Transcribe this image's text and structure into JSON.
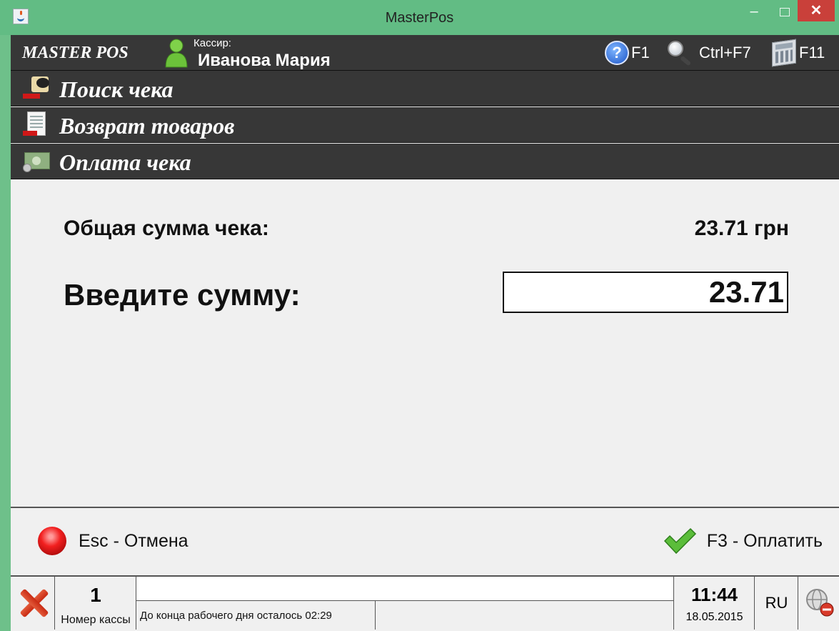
{
  "window": {
    "title": "MasterPos",
    "minimize": "–",
    "close": "✕"
  },
  "header": {
    "brand": "MASTER POS",
    "cashier_label": "Кассир:",
    "cashier_name": "Иванова Мария",
    "hotkeys": {
      "help": "F1",
      "search": "Ctrl+F7",
      "calculator": "F11"
    }
  },
  "menu": [
    {
      "label": "Поиск чека",
      "icon": "search-receipt-icon"
    },
    {
      "label": "Возврат товаров",
      "icon": "return-goods-icon"
    },
    {
      "label": "Оплата чека",
      "icon": "money-icon"
    }
  ],
  "payment": {
    "total_label": "Общая сумма чека:",
    "total_value": "23.71 грн",
    "enter_label": "Введите сумму:",
    "amount": "23.71"
  },
  "actions": {
    "cancel": "Esc - Отмена",
    "pay": "F3 - Оплатить"
  },
  "status": {
    "cash_register_number": "1",
    "cash_register_label": "Номер кассы",
    "shift_info": "До конца рабочего дня осталось 02:29",
    "time": "11:44",
    "date": "18.05.2015",
    "language": "RU"
  },
  "colors": {
    "window_frame": "#62bc84",
    "header_bg": "#373737",
    "close_button": "#c9403a",
    "content_bg": "#f0f0f0"
  }
}
